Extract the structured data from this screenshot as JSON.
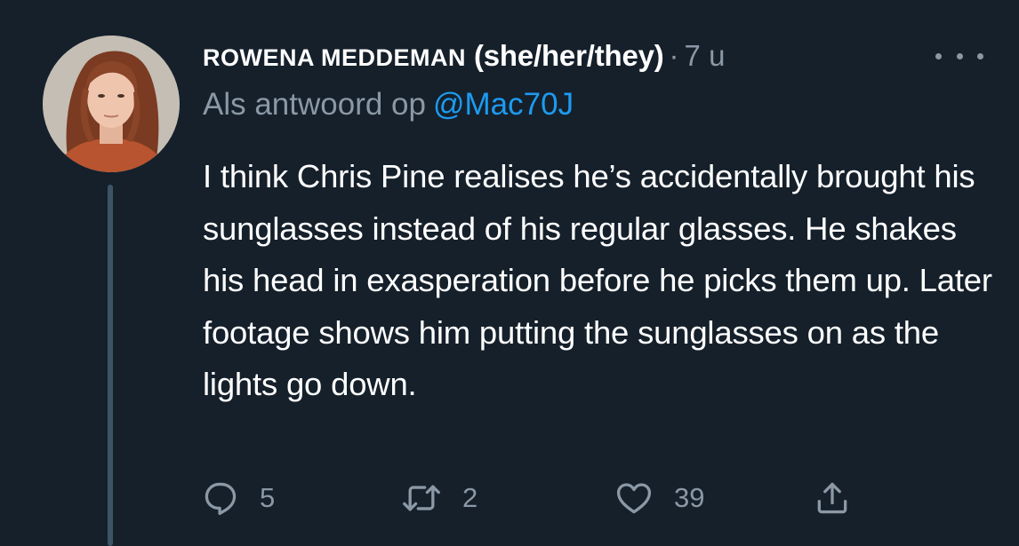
{
  "tweet": {
    "author_name_caps": "ROWENA MEDDEMAN",
    "author_pronouns": " (she/her/they)",
    "separator": "·",
    "time": "7 u",
    "reply_prefix": "Als antwoord op",
    "reply_mention": "@Mac70J",
    "text": "I think Chris Pine realises he’s accidentally brought his sunglasses instead of his regular glasses. He shakes his head in exasperation before he picks them up. Later footage shows him putting the sunglasses on as the lights go down.",
    "counts": {
      "replies": "5",
      "retweets": "2",
      "likes": "39"
    }
  },
  "icons": {
    "more": "more-horizontal-icon",
    "reply": "speech-bubble-icon",
    "retweet": "retweet-arrows-icon",
    "like": "heart-icon",
    "share": "share-upload-icon"
  },
  "colors": {
    "background": "#15202b",
    "text": "#ffffff",
    "secondary": "#8b98a5",
    "accent": "#1d9bf0",
    "thread_line": "#3d5466"
  }
}
